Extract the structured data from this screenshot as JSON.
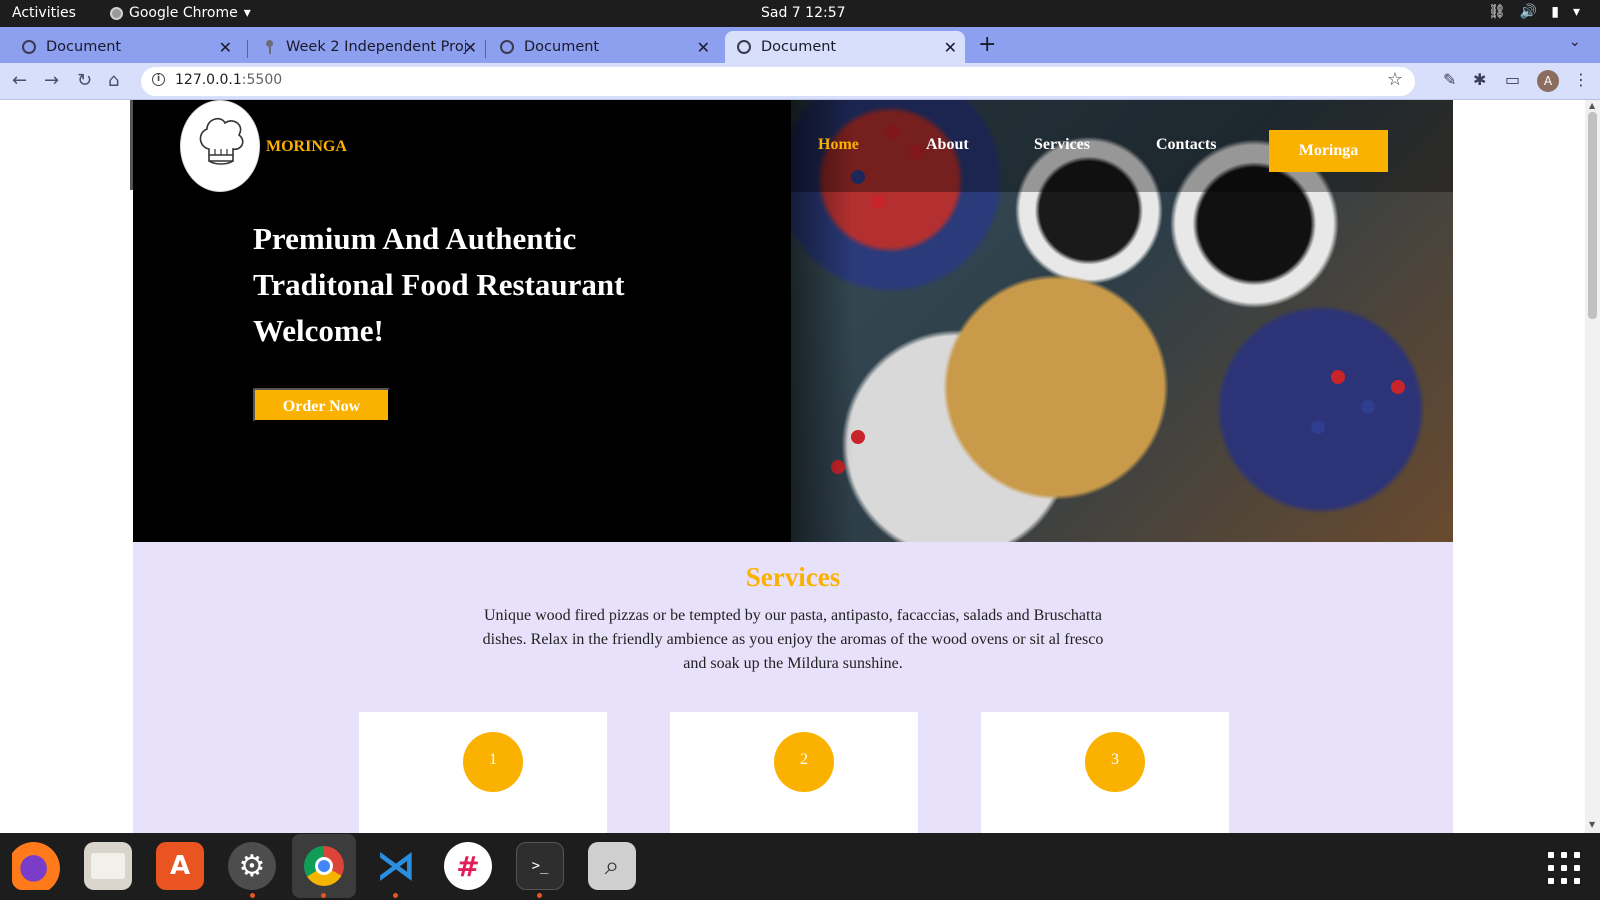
{
  "system": {
    "activities_label": "Activities",
    "app_name": "Google Chrome",
    "clock": "Sad 7  12:57"
  },
  "browser": {
    "tabs": [
      {
        "title": "Document",
        "active": false
      },
      {
        "title": "Week 2 Independent Proj",
        "active": false
      },
      {
        "title": "Document",
        "active": false
      },
      {
        "title": "Document",
        "active": true
      }
    ],
    "address": {
      "host": "127.0.0.1",
      "port": ":5500"
    },
    "profile_initial": "A"
  },
  "site": {
    "brand": "MORINGA",
    "nav": [
      {
        "label": "Home",
        "active": true
      },
      {
        "label": "About",
        "active": false
      },
      {
        "label": "Services",
        "active": false
      },
      {
        "label": "Contacts",
        "active": false
      }
    ],
    "nav_cta": "Moringa",
    "hero": {
      "line1": "Premium And Authentic",
      "line2": "Traditonal Food Restaurant",
      "line3": "Welcome!",
      "cta": "Order Now"
    },
    "services": {
      "heading": "Services",
      "description": "Unique wood fired pizzas or be tempted by our pasta, antipasto, facaccias, salads and Bruschatta dishes. Relax in the friendly ambience as you enjoy the aromas of the wood ovens or sit al fresco and soak up the Mildura sunshine.",
      "cards": [
        {
          "number": "1"
        },
        {
          "number": "2"
        },
        {
          "number": "3"
        }
      ]
    }
  },
  "colors": {
    "accent": "#fbb100",
    "hero_bg": "#000000",
    "services_bg": "#e8e1fb"
  },
  "dock": {
    "apps": [
      "firefox-icon",
      "files-icon",
      "software-icon",
      "settings-icon",
      "chrome-icon",
      "vscode-icon",
      "slack-icon",
      "terminal-icon",
      "screenshot-icon"
    ]
  }
}
